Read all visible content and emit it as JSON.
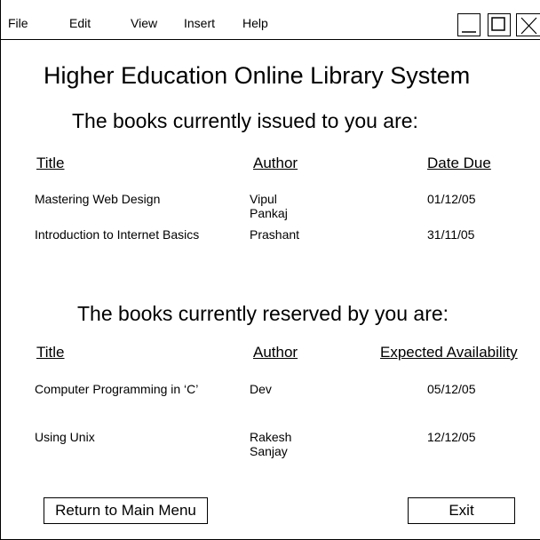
{
  "menu": [
    "File",
    "Edit",
    "View",
    "Insert",
    "Help"
  ],
  "window_controls": {
    "minimize_icon": "minimize-icon",
    "maximize_icon": "maximize-icon",
    "close_icon": "close-icon"
  },
  "title": "Higher Education Online Library System",
  "issued": {
    "heading": "The books currently issued to you are:",
    "columns": [
      "Title",
      "Author",
      "Date Due"
    ],
    "rows": [
      {
        "title": "Mastering Web Design",
        "author": "Vipul\nPankaj",
        "date": "01/12/05"
      },
      {
        "title": "Introduction to Internet Basics",
        "author": "Prashant",
        "date": "31/11/05"
      }
    ]
  },
  "reserved": {
    "heading": "The books currently reserved by you are:",
    "columns": [
      "Title",
      "Author",
      "Expected Availability"
    ],
    "rows": [
      {
        "title": "Computer Programming in ‘C’",
        "author": "Dev",
        "date": "05/12/05"
      },
      {
        "title": "Using Unix",
        "author": "Rakesh\nSanjay",
        "date": "12/12/05"
      }
    ]
  },
  "buttons": {
    "return_label": "Return to Main Menu",
    "exit_label": "Exit"
  }
}
